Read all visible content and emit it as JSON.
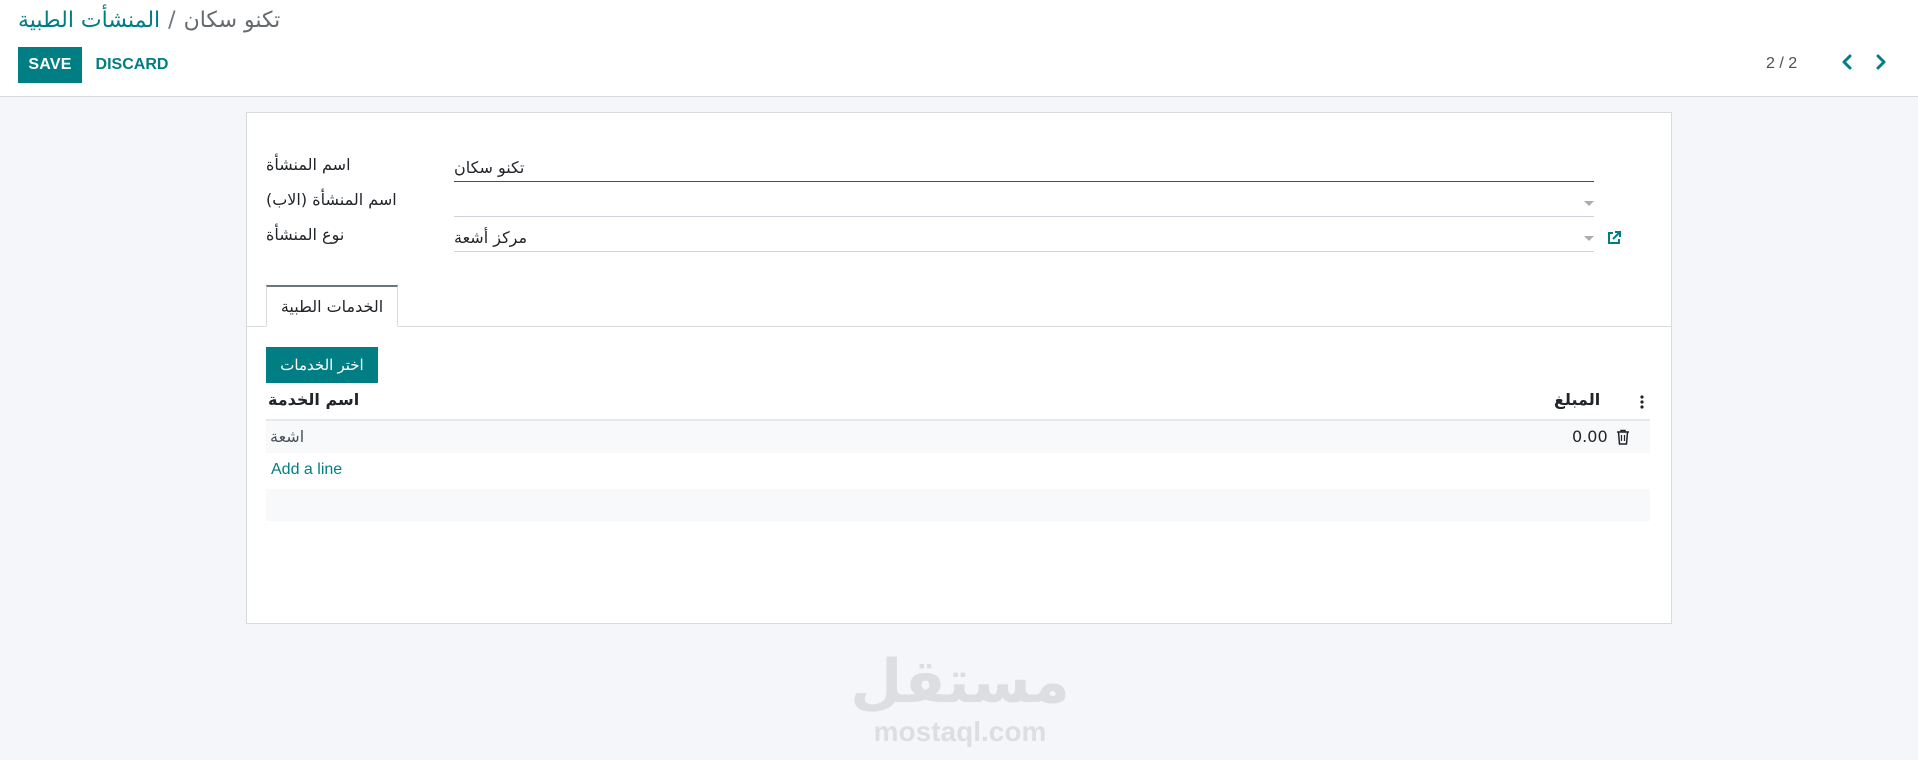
{
  "breadcrumb": {
    "parent": "المنشأت الطبية",
    "separator": "/",
    "current": "تكنو سكان"
  },
  "toolbar": {
    "save_label": "SAVE",
    "discard_label": "DISCARD"
  },
  "pager": {
    "value": "2 / 2"
  },
  "form": {
    "facility_name": {
      "label": "اسم المنشأة",
      "value": "تكنو سكان"
    },
    "parent_facility": {
      "label": "اسم المنشأة (الاب)",
      "value": ""
    },
    "facility_type": {
      "label": "نوع المنشأة",
      "value": "مركز أشعة"
    }
  },
  "tabs": [
    {
      "label": "الخدمات الطبية",
      "active": true
    }
  ],
  "services": {
    "choose_button": "اختر الخدمات",
    "columns": {
      "service_name": "اسم الخدمة",
      "amount": "المبلغ"
    },
    "rows": [
      {
        "service_name": "اشعة",
        "amount": "0.00"
      }
    ],
    "add_line": "Add a line"
  },
  "watermark": {
    "arabic": "مستقل",
    "latin": "mostaql.com"
  },
  "colors": {
    "accent": "#017e84",
    "background": "#f5f6f9"
  },
  "icons": {
    "prev": "chevron-left-icon",
    "next": "chevron-right-icon",
    "external": "external-link-icon",
    "delete": "trash-icon",
    "optional_columns": "vertical-dots-icon"
  }
}
